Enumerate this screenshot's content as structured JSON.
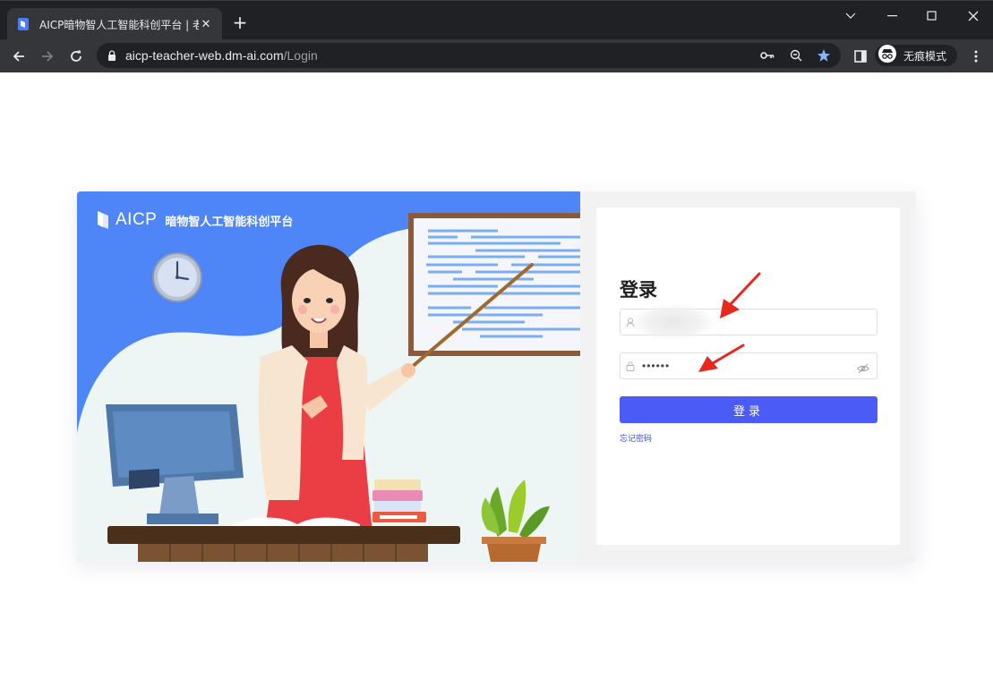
{
  "browser": {
    "tab": {
      "title": "AICP暗物智人工智能科创平台 | 老",
      "close": "✕",
      "new_tab": "+"
    },
    "window_controls": {
      "minimize": "—",
      "maximize": "☐",
      "close": "✕"
    },
    "url": {
      "host": "aicp-teacher-web.dm-ai.com",
      "path": "/Login"
    },
    "profile_label": "无痕模式",
    "colors": {
      "frame": "#202124",
      "toolbar": "#35363a",
      "bookmark_star": "#8ab4f8"
    }
  },
  "brand": {
    "logo_text": "AICP",
    "platform_name": "暗物智人工智能科创平台"
  },
  "login": {
    "title": "登录",
    "username_value": "",
    "password_value": "••••••",
    "submit_label": "登录",
    "forgot_label": "忘记密码",
    "colors": {
      "primary": "#4a5cf5",
      "link": "#3b4bd8",
      "annotation_arrow": "#e8271e"
    }
  },
  "icons": {
    "tab_favicon": "doc-icon",
    "back": "arrow-left-icon",
    "forward": "arrow-right-icon",
    "reload": "reload-icon",
    "lock": "lock-icon",
    "key": "key-icon",
    "zoom": "zoom-out-icon",
    "star": "star-icon",
    "side_panel": "side-panel-icon",
    "incognito": "incognito-icon",
    "menu": "more-vert-icon",
    "user": "user-icon",
    "password_lock": "lock-icon",
    "eye": "eye-off-icon"
  }
}
